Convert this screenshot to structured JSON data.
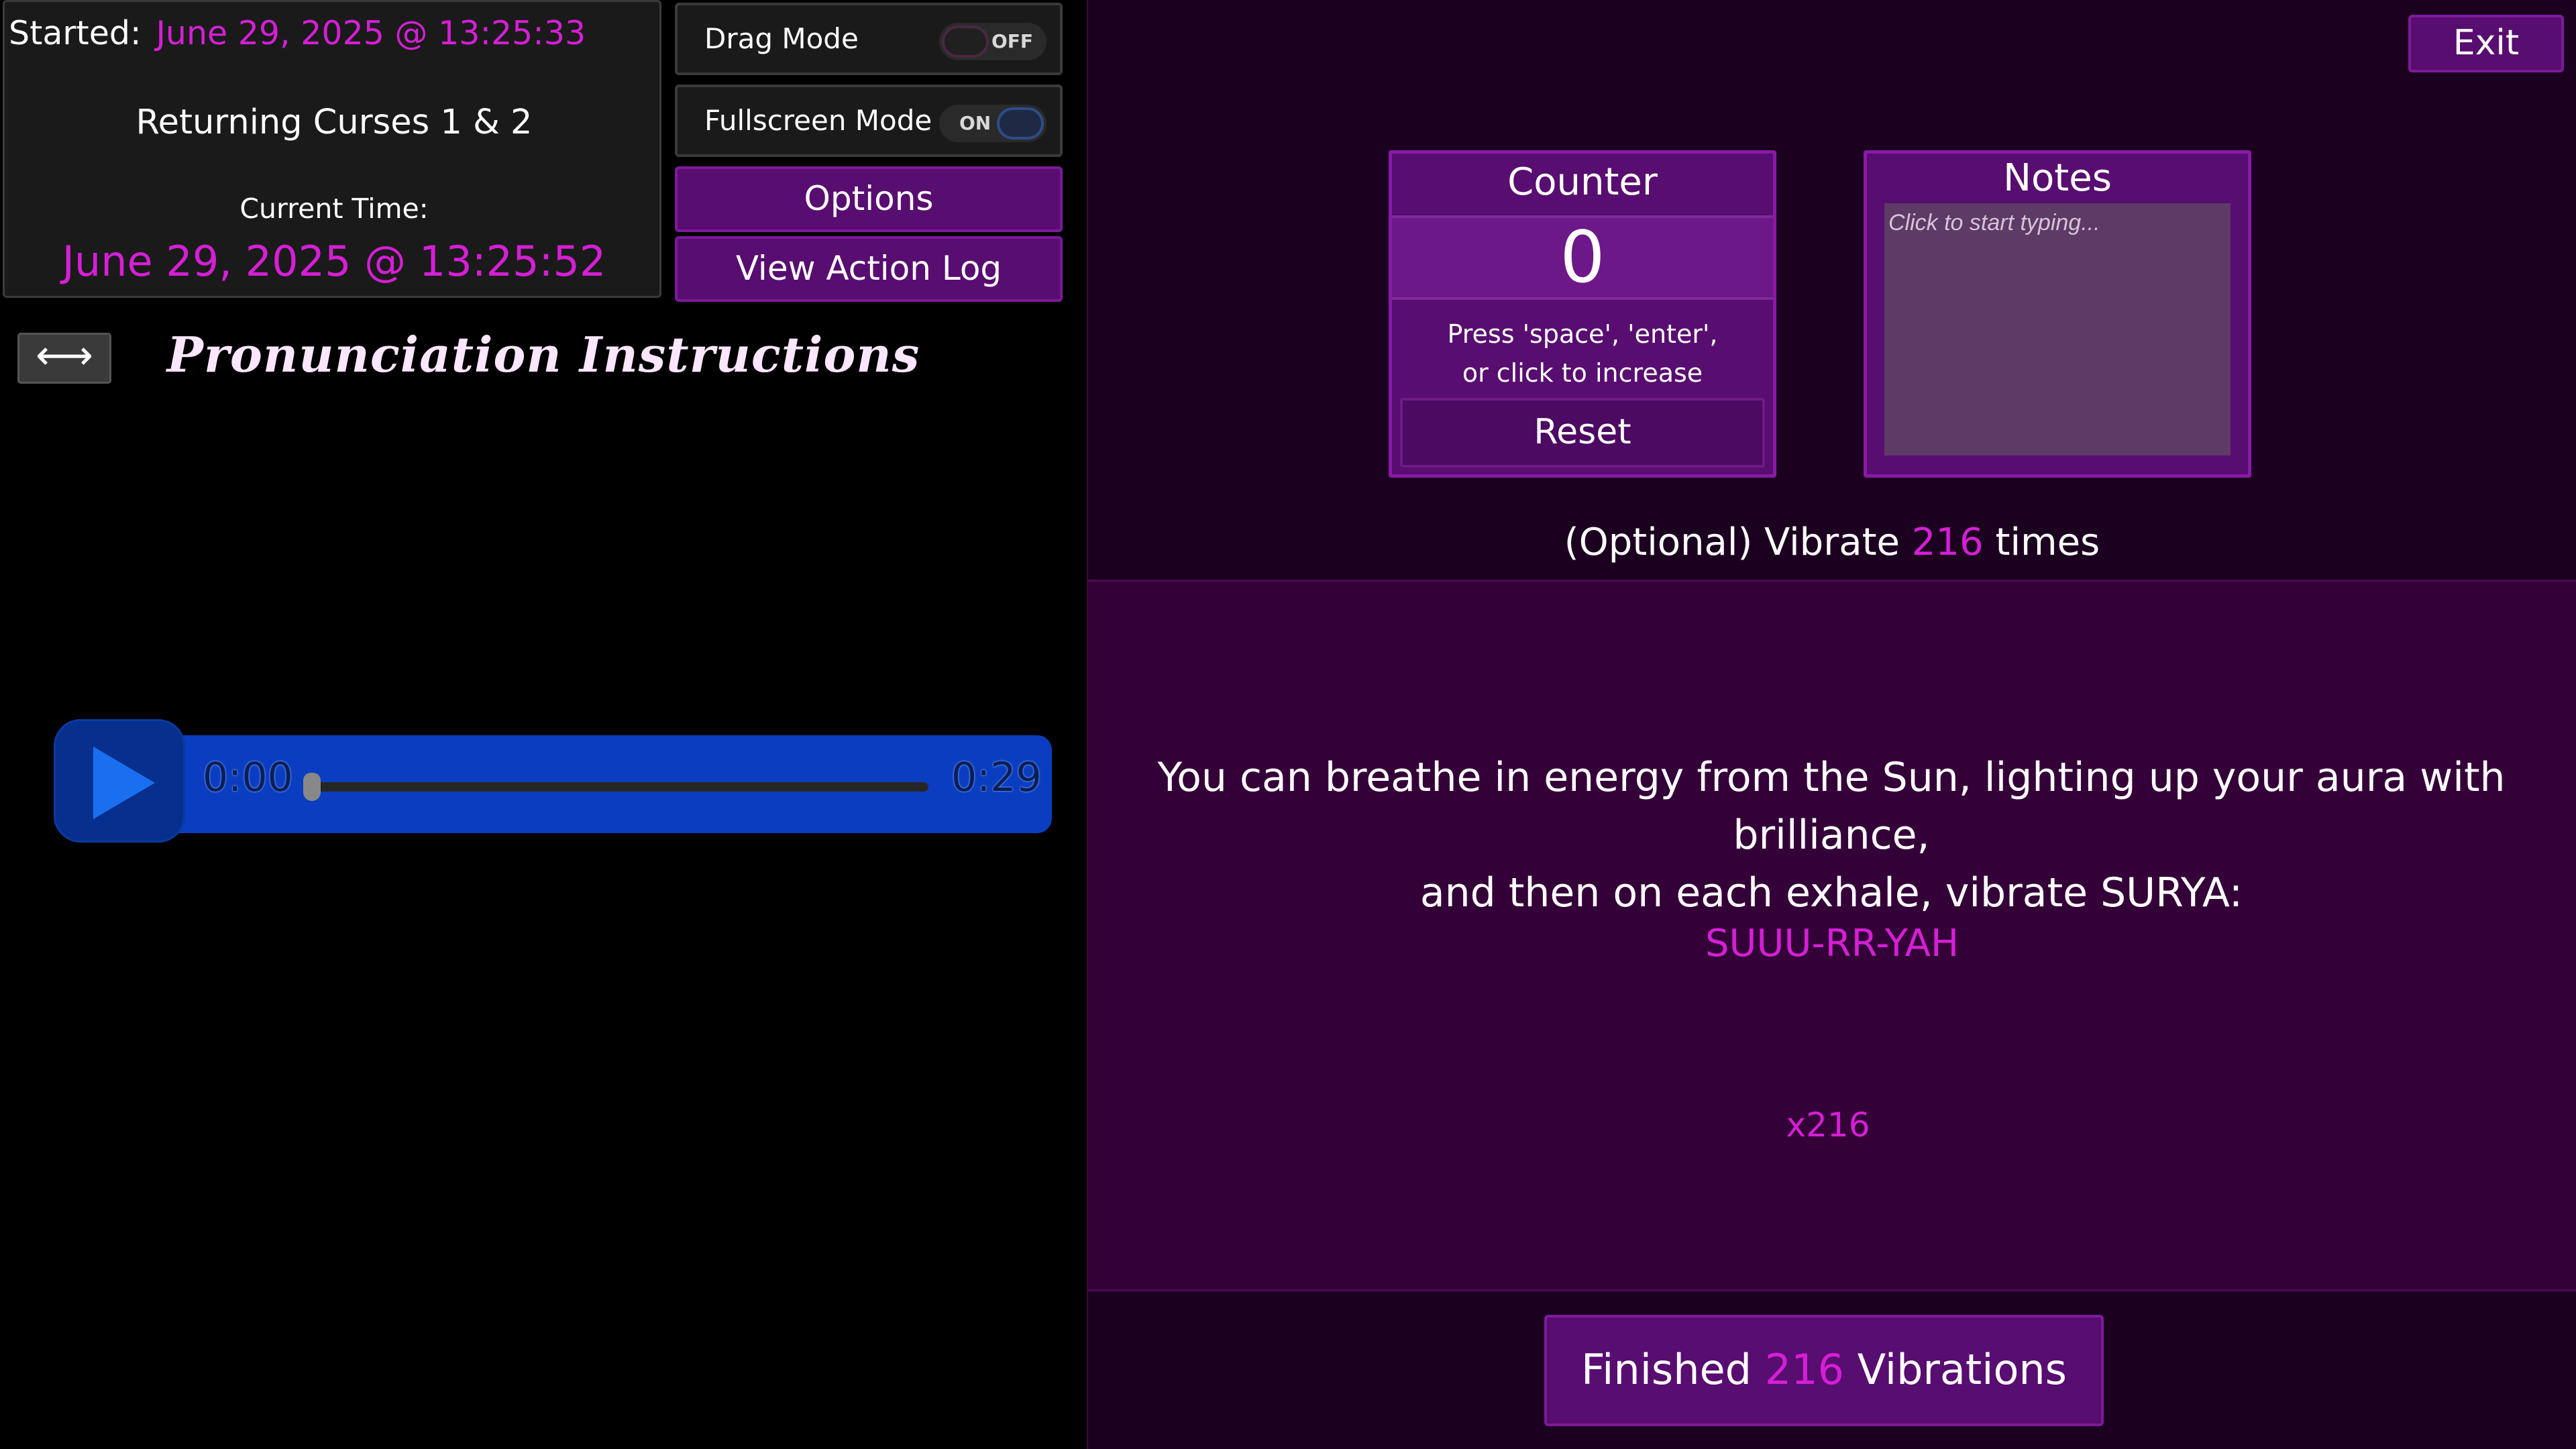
{
  "session": {
    "started_label": "Started:",
    "started_value": "June 29, 2025 @ 13:25:33",
    "ritual_name": "Returning Curses 1 & 2",
    "current_time_label": "Current Time:",
    "current_time_value": "June 29, 2025 @ 13:25:52"
  },
  "controls": {
    "drag_mode": {
      "label": "Drag Mode",
      "state": "OFF"
    },
    "fullscreen_mode": {
      "label": "Fullscreen Mode",
      "state": "ON"
    },
    "options_label": "Options",
    "action_log_label": "View Action Log",
    "swap_icon": "left-right-arrow-icon",
    "swap_glyph": "⟷"
  },
  "pronunciation": {
    "title": "Pronunciation Instructions"
  },
  "audio": {
    "play_icon": "play-icon",
    "current_time": "0:00",
    "duration": "0:29",
    "progress": 0.0
  },
  "exit_label": "Exit",
  "counter": {
    "title": "Counter",
    "value": "0",
    "hint_line1": "Press 'space', 'enter',",
    "hint_line2": "or click to increase",
    "reset_label": "Reset"
  },
  "notes": {
    "title": "Notes",
    "placeholder": "Click to start typing..."
  },
  "vibrate": {
    "prefix": "(Optional) Vibrate",
    "count": "216",
    "suffix": "times"
  },
  "instruction": {
    "line1": "You can breathe in energy from the Sun, lighting up your aura with brilliance,",
    "line2": "and then on each exhale, vibrate SURYA:",
    "mantra": "SUUU-RR-YAH",
    "reps": "x216"
  },
  "finished": {
    "prefix": "Finished",
    "count": "216",
    "suffix": "Vibrations"
  },
  "colors": {
    "accent": "#d51fd5",
    "button_purple": "#580d70",
    "audio_blue": "#0a3dbf"
  }
}
